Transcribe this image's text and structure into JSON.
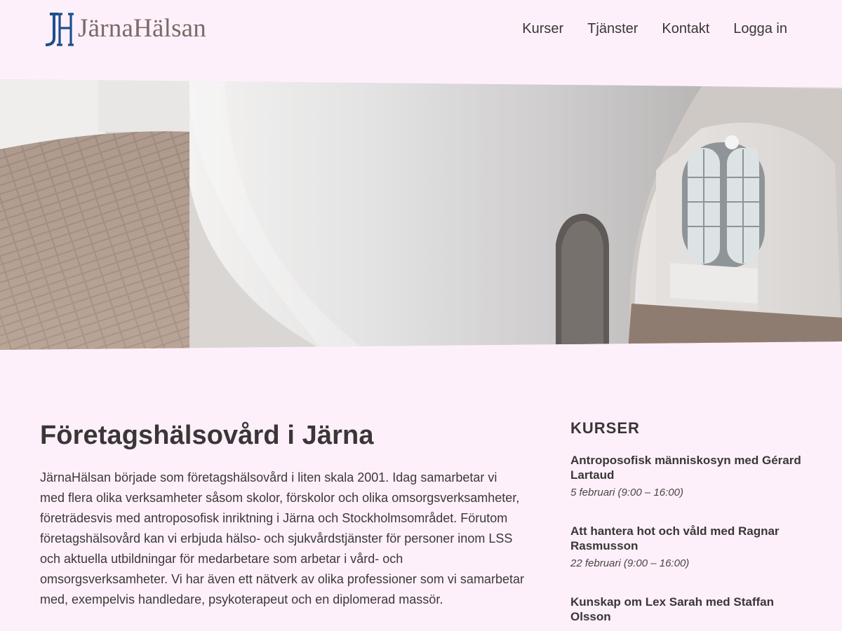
{
  "header": {
    "logo_text": "JärnaHälsan",
    "nav": [
      {
        "label": "Kurser"
      },
      {
        "label": "Tjänster"
      },
      {
        "label": "Kontakt"
      },
      {
        "label": "Logga in"
      }
    ]
  },
  "main": {
    "title": "Företagshälsovård i Järna",
    "intro": "JärnaHälsan började som företagshälsovård i liten skala 2001. Idag samarbetar vi med flera olika verksamheter såsom skolor, förskolor och olika omsorgsverksamheter, företrädesvis med antroposofisk inriktning i Järna och Stockholmsområdet. Förutom företagshälsovård kan vi erbjuda hälso- och sjukvårdstjänster för personer inom LSS och aktuella utbildningar för medarbetare som arbetar i vård- och omsorgsverksamheter. Vi har även ett nätverk av olika professioner som vi samarbetar med, exempelvis handledare, psykoterapeut och en diplomerad massör."
  },
  "sidebar": {
    "heading": "KURSER",
    "courses": [
      {
        "title": "Antroposofisk människosyn med Gérard Lartaud",
        "date": "5 februari (9:00 – 16:00)"
      },
      {
        "title": "Att hantera hot och våld med Ragnar Rasmusson",
        "date": "22 februari (9:00 – 16:00)"
      },
      {
        "title": "Kunskap om Lex Sarah med Staffan Olsson",
        "date": ""
      }
    ]
  },
  "colors": {
    "background": "#fdf0fb",
    "text": "#3a3636",
    "logo_blue": "#1d4f8c",
    "logo_gray": "#7a6b66"
  }
}
